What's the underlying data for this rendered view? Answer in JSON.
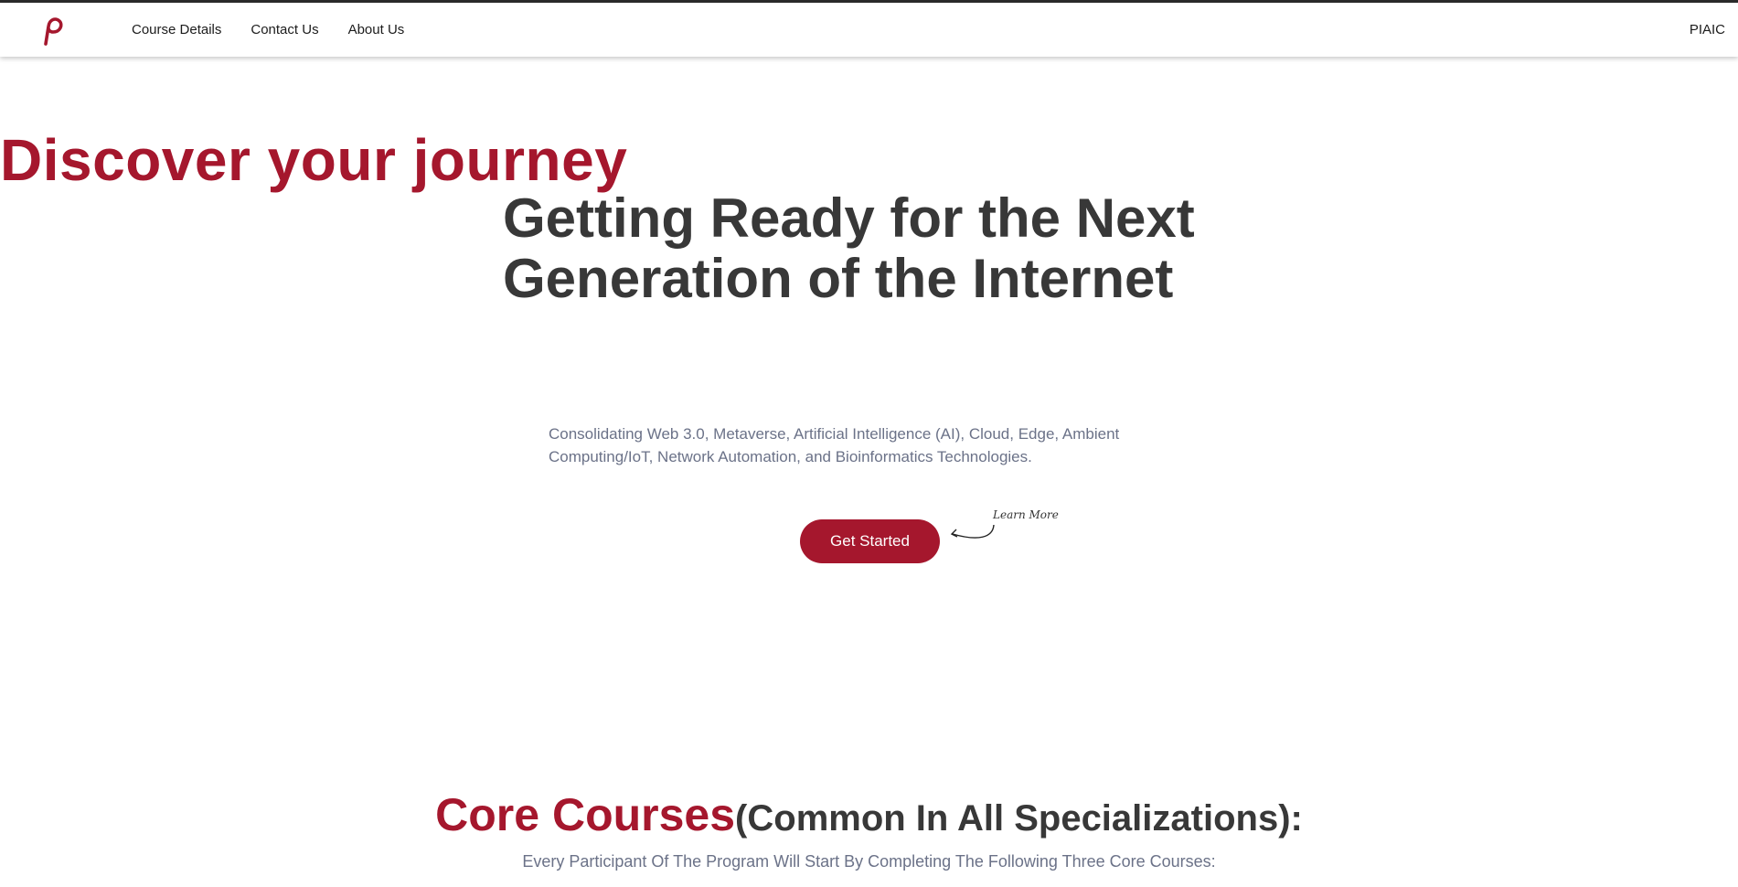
{
  "nav": {
    "logo_icon": "piaic-p-logo-icon",
    "links": [
      "Course Details",
      "Contact Us",
      "About Us"
    ],
    "brand": "PIAIC"
  },
  "hero": {
    "title_accent": "Discover your journey",
    "title_main": "Getting Ready for the Next Generation of the Internet",
    "subtitle": "Consolidating Web 3.0, Metaverse, Artificial Intelligence (AI), Cloud, Edge, Ambient Computing/IoT, Network Automation, and Bioinformatics Technologies.",
    "cta_label": "Get Started",
    "learn_more": "Learn More"
  },
  "core": {
    "heading_accent": "Core Courses",
    "heading_rest": "(Common In All Specializations):",
    "subheading": "Every Participant Of The Program Will Start By Completing The Following Three Core Courses:"
  },
  "colors": {
    "accent": "#a5172d",
    "dark_text": "#383838",
    "muted_text": "#6b7288"
  }
}
